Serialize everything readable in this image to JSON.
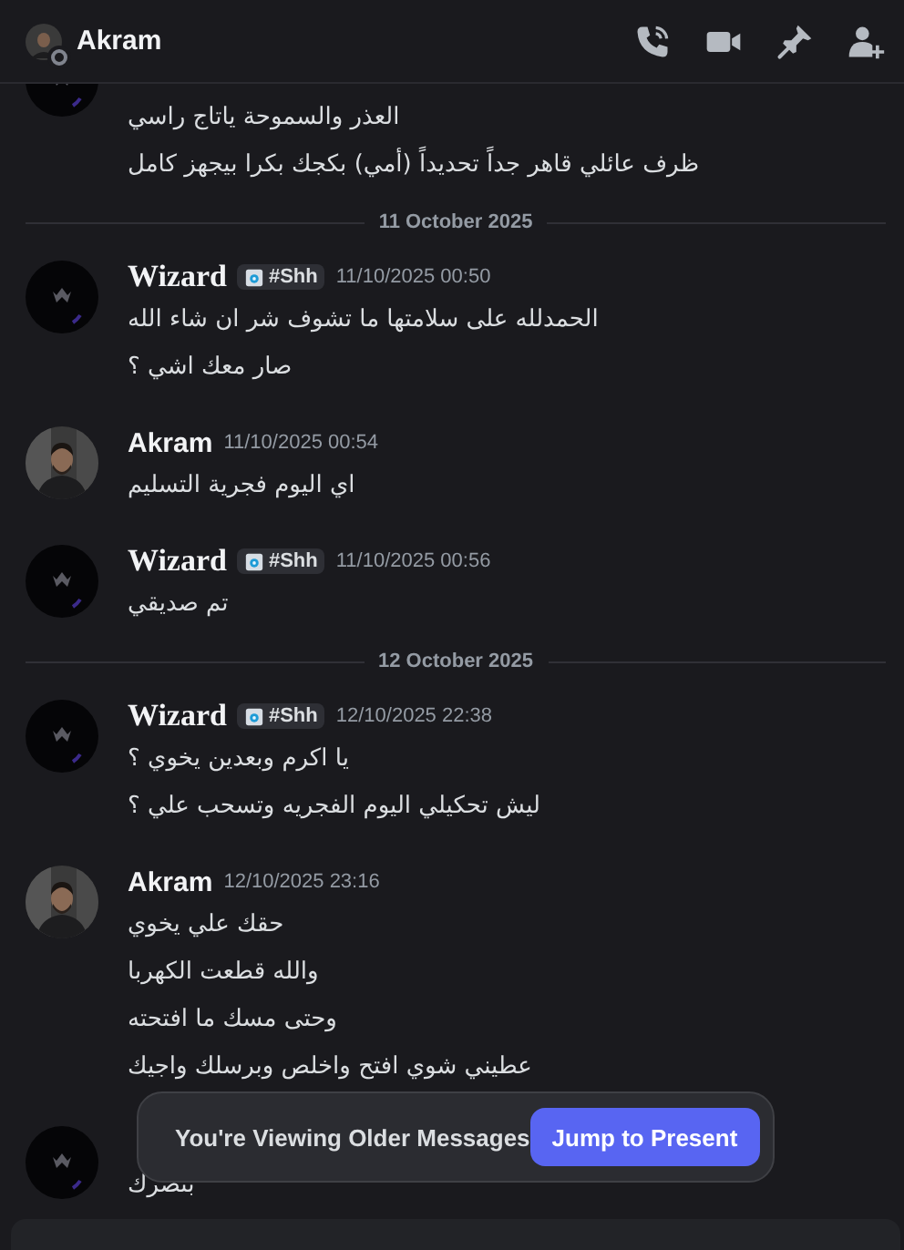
{
  "header": {
    "name": "Akram",
    "online": false
  },
  "feed": [
    {
      "kind": "logo_cut",
      "lines": [
        "العذر والسموحة ياتاج راسي",
        "ظرف عائلي قاهر جداً تحديداً (أمي) بكجك بكرا بيجهز كامل"
      ]
    },
    {
      "kind": "divider",
      "text": "11 October 2025"
    },
    {
      "kind": "logo_group",
      "author": "Wizard",
      "badge": "#Shh",
      "time": "11/10/2025 00:50",
      "lines": [
        "الحمدلله على سلامتها ما تشوف شر ان شاء الله",
        "صار معك اشي ؟"
      ]
    },
    {
      "kind": "photo_group",
      "author": "Akram",
      "time": "11/10/2025 00:54",
      "lines": [
        "اي اليوم فجرية التسليم"
      ]
    },
    {
      "kind": "logo_group",
      "author": "Wizard",
      "badge": "#Shh",
      "time": "11/10/2025 00:56",
      "lines": [
        "تم صديقي"
      ]
    },
    {
      "kind": "divider",
      "text": "12 October 2025"
    },
    {
      "kind": "logo_group",
      "author": "Wizard",
      "badge": "#Shh",
      "time": "12/10/2025 22:38",
      "lines": [
        "يا اكرم وبعدين يخوي ؟",
        "ليش تحكيلي اليوم الفجريه وتسحب علي ؟"
      ]
    },
    {
      "kind": "photo_group",
      "author": "Akram",
      "time": "12/10/2025 23:16",
      "lines": [
        "حقك علي يخوي",
        "والله قطعت الكهربا",
        "وحتى مسك ما افتحته",
        "عطيني شوي افتح واخلص وبرسلك واجيك"
      ]
    },
    {
      "kind": "logo_group",
      "lines": [
        "بنصرك"
      ]
    }
  ],
  "toast": {
    "text": "You're Viewing Older Messages",
    "button": "Jump to Present"
  }
}
